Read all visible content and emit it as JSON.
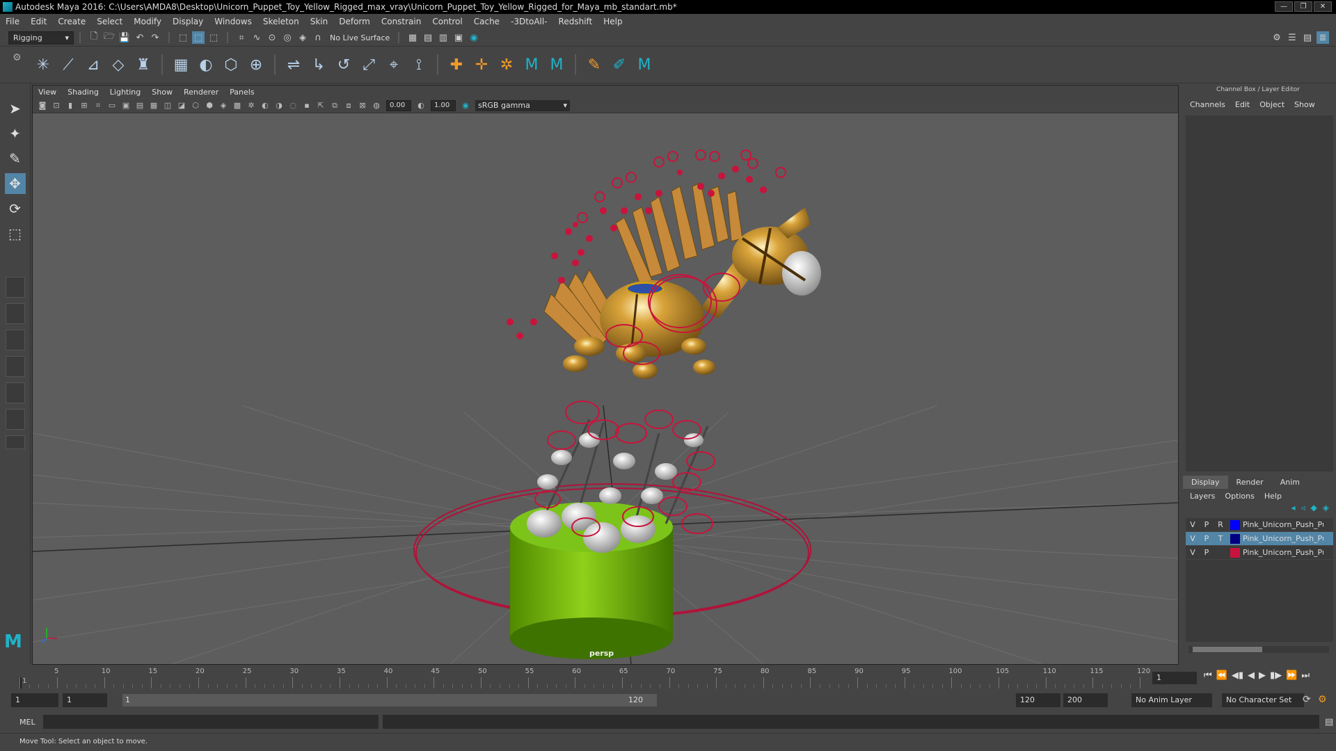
{
  "window": {
    "title": "Autodesk Maya 2016: C:\\Users\\AMDA8\\Desktop\\Unicorn_Puppet_Toy_Yellow_Rigged_max_vray\\Unicorn_Puppet_Toy_Yellow_Rigged_for_Maya_mb_standart.mb*",
    "controls": [
      "—",
      "❐",
      "✕"
    ]
  },
  "menubar": [
    "File",
    "Edit",
    "Create",
    "Select",
    "Modify",
    "Display",
    "Windows",
    "Skeleton",
    "Skin",
    "Deform",
    "Constrain",
    "Control",
    "Cache",
    "-3DtoAll-",
    "Redshift",
    "Help"
  ],
  "toolbar": {
    "mode": "Rigging",
    "live_surface": "No Live Surface"
  },
  "viewport": {
    "menu": [
      "View",
      "Shading",
      "Lighting",
      "Show",
      "Renderer",
      "Panels"
    ],
    "exposure": "0.00",
    "gamma": "1.00",
    "color_space": "sRGB gamma",
    "camera_label": "persp"
  },
  "channel_box": {
    "header": "Channel Box / Layer Editor",
    "menu": [
      "Channels",
      "Edit",
      "Object",
      "Show"
    ],
    "tabs": [
      "Display",
      "Render",
      "Anim"
    ],
    "active_tab": "Display",
    "layer_menu": [
      "Layers",
      "Options",
      "Help"
    ],
    "layers": [
      {
        "v": "V",
        "p": "P",
        "t": "R",
        "color": "#0000ff",
        "name": "Pink_Unicorn_Push_Pu"
      },
      {
        "v": "V",
        "p": "P",
        "t": "T",
        "color": "#000080",
        "name": "Pink_Unicorn_Push_Pu"
      },
      {
        "v": "V",
        "p": "P",
        "t": "",
        "color": "#c8143c",
        "name": "Pink_Unicorn_Push_Pu"
      }
    ]
  },
  "timeline": {
    "ticks": [
      "1",
      "5",
      "10",
      "15",
      "20",
      "25",
      "30",
      "35",
      "40",
      "45",
      "50",
      "55",
      "60",
      "65",
      "70",
      "75",
      "80",
      "85",
      "90",
      "95",
      "100",
      "105",
      "110",
      "115",
      "120"
    ],
    "current_frame": "1"
  },
  "range": {
    "start": "1",
    "playback_start": "1",
    "slider_start": "1",
    "slider_end": "120",
    "playback_end": "120",
    "end": "200",
    "anim_layer": "No Anim Layer",
    "character_set": "No Character Set"
  },
  "command_line": {
    "label": "MEL"
  },
  "status": "Move Tool: Select an object to move."
}
